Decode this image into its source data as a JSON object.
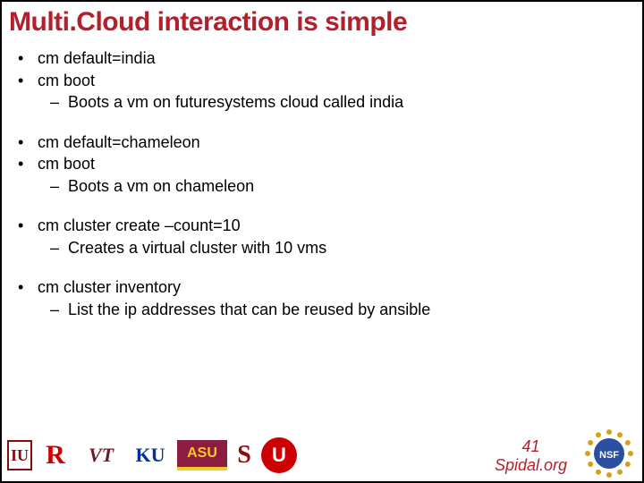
{
  "title": "Multi.Cloud interaction is simple",
  "groups": [
    {
      "items": [
        {
          "level": 1,
          "text": "cm default=india"
        },
        {
          "level": 1,
          "text": "cm boot"
        },
        {
          "level": 2,
          "text": "Boots a vm on futuresystems cloud called india"
        }
      ]
    },
    {
      "items": [
        {
          "level": 1,
          "text": "cm default=chameleon"
        },
        {
          "level": 1,
          "text": "cm boot"
        },
        {
          "level": 2,
          "text": "Boots a vm on chameleon"
        }
      ]
    },
    {
      "items": [
        {
          "level": 1,
          "text": "cm cluster create –count=10"
        },
        {
          "level": 2,
          "text": "Creates a virtual cluster with 10 vms"
        }
      ]
    },
    {
      "items": [
        {
          "level": 1,
          "text": "cm cluster inventory"
        },
        {
          "level": 2,
          "text": "List the ip addresses that can be reused by ansible"
        }
      ]
    }
  ],
  "footer": {
    "page_number": "41",
    "site": "Spidal.org",
    "logos": {
      "iu": "IU",
      "rutgers": "R",
      "vt": "VT",
      "ku": "KU",
      "asu": "ASU",
      "sb": "S",
      "utah": "U",
      "nsf": "NSF"
    }
  }
}
